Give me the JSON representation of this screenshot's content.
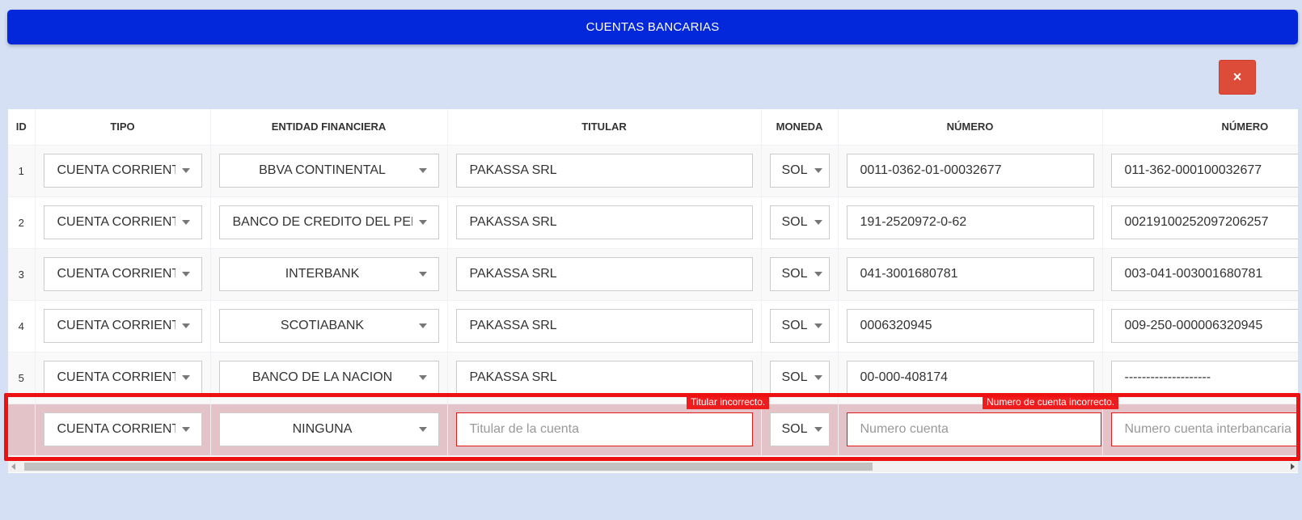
{
  "header": {
    "title": "CUENTAS BANCARIAS"
  },
  "toolbar": {
    "close_icon": "×"
  },
  "table": {
    "columns": [
      "ID",
      "TIPO",
      "ENTIDAD FINANCIERA",
      "TITULAR",
      "MONEDA",
      "NÚMERO",
      "NÚMERO"
    ],
    "rows": [
      {
        "id": "1",
        "tipo": "CUENTA CORRIENTE",
        "entidad": "BBVA CONTINENTAL",
        "titular": "PAKASSA SRL",
        "moneda": "SOL",
        "numero": "0011-0362-01-00032677",
        "interbancario": "011-362-000100032677"
      },
      {
        "id": "2",
        "tipo": "CUENTA CORRIENTE",
        "entidad": "BANCO DE CREDITO DEL PERU",
        "titular": "PAKASSA SRL",
        "moneda": "SOL",
        "numero": "191-2520972-0-62",
        "interbancario": "00219100252097206257"
      },
      {
        "id": "3",
        "tipo": "CUENTA CORRIENTE",
        "entidad": "INTERBANK",
        "titular": "PAKASSA SRL",
        "moneda": "SOL",
        "numero": "041-3001680781",
        "interbancario": "003-041-003001680781"
      },
      {
        "id": "4",
        "tipo": "CUENTA CORRIENTE",
        "entidad": "SCOTIABANK",
        "titular": "PAKASSA SRL",
        "moneda": "SOL",
        "numero": "0006320945",
        "interbancario": "009-250-000006320945"
      },
      {
        "id": "5",
        "tipo": "CUENTA CORRIENTE",
        "entidad": "BANCO DE LA NACION",
        "titular": "PAKASSA SRL",
        "moneda": "SOL",
        "numero": "00-000-408174",
        "interbancario": "--------------------"
      }
    ],
    "new_row": {
      "tipo": "CUENTA CORRIENTE",
      "entidad": "NINGUNA",
      "titular_placeholder": "Titular de la cuenta",
      "moneda": "SOL",
      "numero_placeholder": "Numero cuenta",
      "interbancario_placeholder": "Numero cuenta interbancaria",
      "titular_error": "Titular incorrecto.",
      "numero_error": "Numero de cuenta incorrecto."
    }
  },
  "colors": {
    "header": "#0328db",
    "close_button": "#dd4b39",
    "error": "#ee1c1c",
    "background": "#d5e0f4"
  }
}
